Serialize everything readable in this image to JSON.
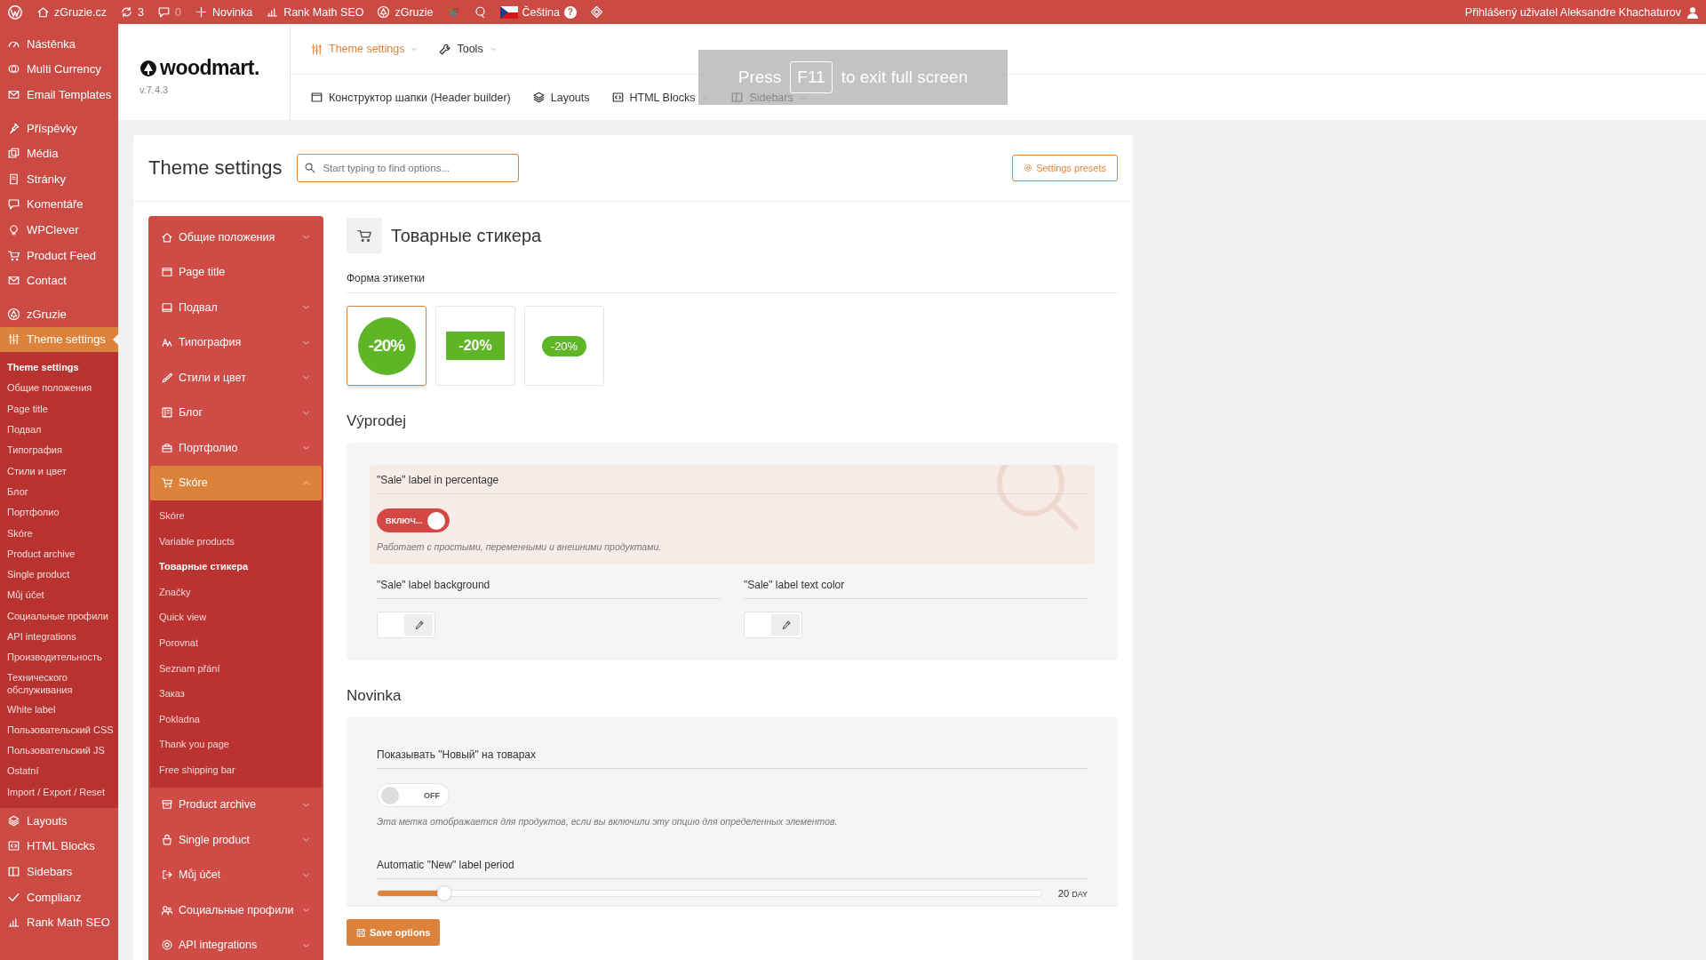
{
  "admin_bar": {
    "items": [
      {
        "kind": "wp"
      },
      {
        "kind": "home",
        "label": "zGruzie.cz"
      },
      {
        "kind": "updates",
        "label": "3"
      },
      {
        "kind": "comments",
        "label": "0"
      },
      {
        "kind": "new",
        "label": "Novinka"
      },
      {
        "kind": "chart",
        "label": "Rank Math SEO"
      },
      {
        "kind": "tree",
        "label": "zGruzie"
      },
      {
        "kind": "hex"
      },
      {
        "kind": "q"
      },
      {
        "kind": "flag",
        "label": "Čeština",
        "badge": "?"
      },
      {
        "kind": "diamond"
      }
    ],
    "user": "Přihlášený uživatel Aleksandre Khachaturov"
  },
  "admin_menu": {
    "groups": [
      [
        {
          "label": "Nástěnka",
          "selected": false
        },
        {
          "label": "Multi Currency",
          "selected": false
        },
        {
          "label": "Email Templates",
          "selected": false
        }
      ],
      [
        {
          "label": "Příspěvky",
          "selected": false
        },
        {
          "label": "Média",
          "selected": false
        },
        {
          "label": "Stránky",
          "selected": false
        },
        {
          "label": "Komentáře",
          "selected": false
        },
        {
          "label": "WPClever",
          "selected": false
        },
        {
          "label": "Product Feed",
          "selected": false
        },
        {
          "label": "Contact",
          "selected": false
        }
      ],
      [
        {
          "label": "zGruzie",
          "selected": false
        },
        {
          "label": "Theme settings",
          "selected": true,
          "children": [
            {
              "label": "Theme settings",
              "selected": true
            },
            {
              "label": "Общие положения",
              "selected": false
            },
            {
              "label": "Page title",
              "selected": false
            },
            {
              "label": "Подвал",
              "selected": false
            },
            {
              "label": "Типография",
              "selected": false
            },
            {
              "label": "Стили и цвет",
              "selected": false
            },
            {
              "label": "Блог",
              "selected": false
            },
            {
              "label": "Портфолио",
              "selected": false
            },
            {
              "label": "Skóre",
              "selected": false
            },
            {
              "label": "Product archive",
              "selected": false
            },
            {
              "label": "Single product",
              "selected": false
            },
            {
              "label": "Můj účet",
              "selected": false
            },
            {
              "label": "Социальные профили",
              "selected": false
            },
            {
              "label": "API integrations",
              "selected": false
            },
            {
              "label": "Производительность",
              "selected": false
            },
            {
              "label": "Технического обслуживания",
              "selected": false
            },
            {
              "label": "White label",
              "selected": false
            },
            {
              "label": "Пользовательский CSS",
              "selected": false
            },
            {
              "label": "Пользовательский JS",
              "selected": false
            },
            {
              "label": "Ostatní",
              "selected": false
            },
            {
              "label": "Import / Export / Reset",
              "selected": false
            }
          ]
        },
        {
          "label": "Layouts",
          "selected": false
        },
        {
          "label": "HTML Blocks",
          "selected": false
        },
        {
          "label": "Sidebars",
          "selected": false
        },
        {
          "label": "Complianz",
          "selected": false
        },
        {
          "label": "Rank Math SEO",
          "selected": false
        }
      ]
    ]
  },
  "header": {
    "logo": "woodmart.",
    "version": "v.7.4.3",
    "top_nav": [
      {
        "label": "Theme settings",
        "dropdown": true,
        "selected": true
      },
      {
        "label": "Tools",
        "dropdown": true,
        "selected": false
      }
    ],
    "sub_nav": [
      {
        "label": "Конструктор шапки (Header builder)",
        "dropdown": false
      },
      {
        "label": "Layouts",
        "dropdown": false
      },
      {
        "label": "HTML Blocks",
        "dropdown": true
      },
      {
        "label": "Sidebars",
        "dropdown": true
      }
    ]
  },
  "fullscreen_notice": {
    "before": "Press",
    "key": "F11",
    "after": "to exit full screen"
  },
  "settings": {
    "title": "Theme settings",
    "search": {
      "placeholder": "Start typing to find options..."
    },
    "presets_button": "Settings presets",
    "menu": [
      {
        "label": "Общие положения",
        "kind": "group",
        "expanded": false
      },
      {
        "label": "Page title",
        "kind": "page",
        "expanded": false
      },
      {
        "label": "Подвал",
        "kind": "group",
        "expanded": false
      },
      {
        "label": "Типография",
        "kind": "group",
        "expanded": false
      },
      {
        "label": "Стили и цвет",
        "kind": "group",
        "expanded": false
      },
      {
        "label": "Блог",
        "kind": "group",
        "expanded": false
      },
      {
        "label": "Портфолио",
        "kind": "group",
        "expanded": false
      },
      {
        "label": "Skóre",
        "kind": "group",
        "expanded": true,
        "children": [
          {
            "label": "Skóre",
            "selected": false
          },
          {
            "label": "Variable products",
            "selected": false
          },
          {
            "label": "Товарные стикера",
            "selected": true
          },
          {
            "label": "Značky",
            "selected": false
          },
          {
            "label": "Quick view",
            "selected": false
          },
          {
            "label": "Porovnat",
            "selected": false
          },
          {
            "label": "Seznam přání",
            "selected": false
          },
          {
            "label": "Заказ",
            "selected": false
          },
          {
            "label": "Pokladna",
            "selected": false
          },
          {
            "label": "Thank you page",
            "selected": false
          },
          {
            "label": "Free shipping bar",
            "selected": false
          }
        ]
      },
      {
        "label": "Product archive",
        "kind": "group",
        "expanded": false
      },
      {
        "label": "Single product",
        "kind": "group",
        "expanded": false
      },
      {
        "label": "Můj účet",
        "kind": "group",
        "expanded": false
      },
      {
        "label": "Социальные профили",
        "kind": "group",
        "expanded": false
      },
      {
        "label": "API integrations",
        "kind": "group",
        "expanded": false
      }
    ],
    "page_title": "Товарные стикера",
    "shape_label": "Форма этикетки",
    "shapes": [
      {
        "kind": "circle",
        "label": "-20%",
        "selected": true
      },
      {
        "kind": "rect",
        "label": "-20%",
        "selected": false
      },
      {
        "kind": "pill",
        "label": "-20%",
        "selected": false
      }
    ],
    "sections": [
      {
        "title": "Výprodej",
        "fields": [
          {
            "kind": "switch",
            "label": "\"Sale\" label in percentage",
            "on": true,
            "switch_text": "ВКЛЮЧ...",
            "description": "Работает с простыми, переменными и внешними продуктами.",
            "highlighted": true
          },
          {
            "kind": "colors",
            "pickers": [
              {
                "label": "\"Sale\" label background"
              },
              {
                "label": "\"Sale\" label text color"
              }
            ]
          }
        ]
      },
      {
        "title": "Novinka",
        "fields": [
          {
            "kind": "switch",
            "label": "Показывать \"Новый\" на товарах",
            "on": false,
            "switch_text": "OFF",
            "description": "Эта метка отображается для продуктов, если вы включили эту опцию для определенных элементов.",
            "highlighted": false
          },
          {
            "kind": "slider",
            "label": "Automatic \"New\" label period",
            "level": 0.1,
            "value": "20",
            "unit": "DAY"
          }
        ]
      }
    ],
    "save_button": "Save options"
  }
}
